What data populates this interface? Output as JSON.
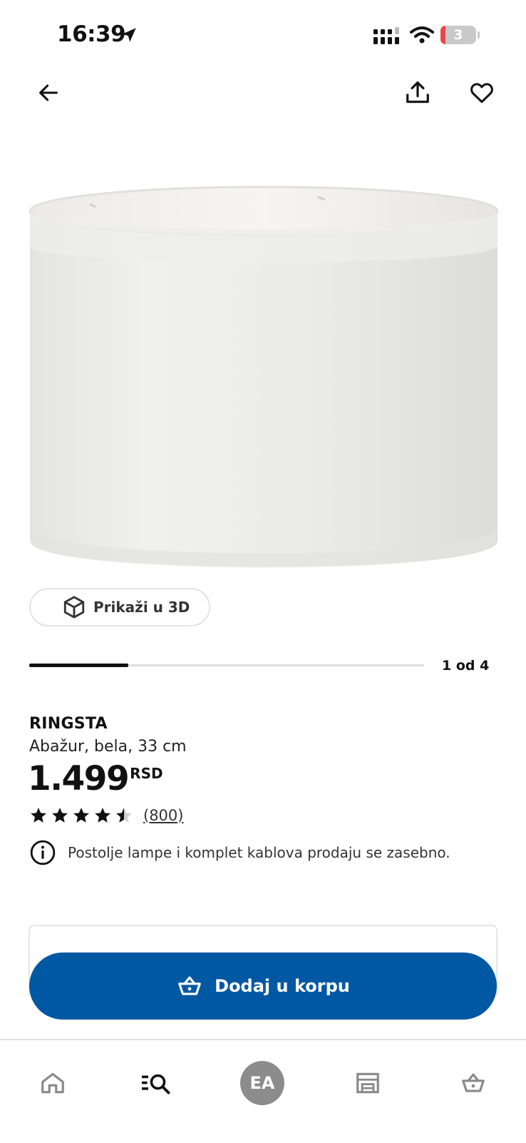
{
  "status_bar": {
    "time": "16:39",
    "battery_level": "3",
    "icons": [
      "location-arrow-icon",
      "cellular-signal-icon",
      "wifi-icon",
      "battery-icon"
    ]
  },
  "header": {
    "icons": [
      "arrow-left-icon",
      "share-icon",
      "heart-icon"
    ]
  },
  "gallery": {
    "view_3d_label": "Prikaži u 3D",
    "counter": "1 od 4",
    "progress": 0.25
  },
  "product": {
    "name": "RINGSTA",
    "description": "Abažur, bela, 33 cm",
    "price": "1.499",
    "currency": "RSD",
    "rating": 4.5,
    "rating_max": 5,
    "review_count": "(800)",
    "info": "Postolje lampe i komplet kablova prodaju se zasebno."
  },
  "cta": {
    "add_to_cart_label": "Dodaj u korpu"
  },
  "bottom_nav": {
    "avatar_initials": "EA",
    "items": [
      "home-icon",
      "search-icon",
      "avatar",
      "stores-icon",
      "cart-icon"
    ]
  },
  "colors": {
    "primary_blue": "#0058a3",
    "battery_low": "#e5484d",
    "avatar_gray": "#8c8c8c"
  }
}
